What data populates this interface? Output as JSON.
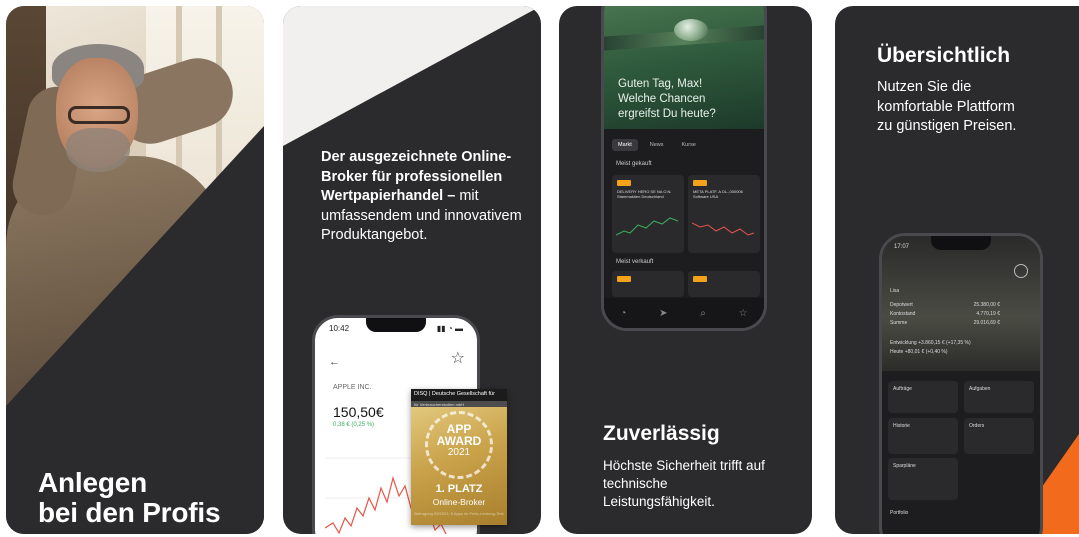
{
  "cards": [
    {
      "title": "Anlegen\nbei den Profis"
    },
    {
      "text_bold": "Der ausgezeichnete Online-Broker für professionellen Wertpapierhandel –",
      "text_rest": " mit umfassendem und innovativem Produktangebot.",
      "phone": {
        "time": "10:42",
        "back": "←",
        "symbol": "APPLE INC.",
        "price": "150,50€",
        "change": "0,38 €  (0,25 %)"
      },
      "award": {
        "header": "DISQ | Deutsche Gesellschaft für",
        "subheader": "für Verbraucherstudien mbH",
        "line1": "APP\nAWARD",
        "year": "2021",
        "place": "1. PLATZ",
        "category": "Online-Broker",
        "fine": "Befragung 09/2021; 6 Apps im Preis-Leistung-Test"
      }
    },
    {
      "title": "Zuverlässig",
      "text": "Höchste Sicherheit trifft auf technische Leistungsfähigkeit.",
      "phone": {
        "greeting": "Guten Tag, Max!\nWelche Chancen\nergreifst Du heute?",
        "tabs": [
          "Markt",
          "News",
          "Kurse"
        ],
        "section_bought": "Meist gekauft",
        "section_sold": "Meist verkauft",
        "tile1": "DELIVERY HERO SE NA O.N. Stammaktien Deutschland",
        "tile2": "META PLATF. A DL-,000006 Software USA"
      }
    },
    {
      "title": "Übersichtlich",
      "text": "Nutzen Sie die\nkomfortable Plattform\nzu günstigen Preisen.",
      "phone": {
        "time": "17:07",
        "name": "Lisa",
        "rows": [
          {
            "label": "Depotwert",
            "value": "25.380,00 €"
          },
          {
            "label": "Kontostand",
            "value": "4.770,19 €"
          },
          {
            "label": "Summe",
            "value": "29.016,69 €"
          }
        ],
        "dev1": "Entwicklung +3.860,15 € (+17,35 %)",
        "dev2": "Heute +80,01 € (+0,40 %)",
        "panels": [
          "Aufträge",
          "Aufgaben",
          "Historie",
          "Orders",
          "Sparpläne"
        ],
        "footer": "Portfolio"
      }
    }
  ],
  "colors": {
    "card_bg": "#2b2b2d",
    "accent_orange": "#f26a1b",
    "award_gold": "#c9a24a"
  }
}
